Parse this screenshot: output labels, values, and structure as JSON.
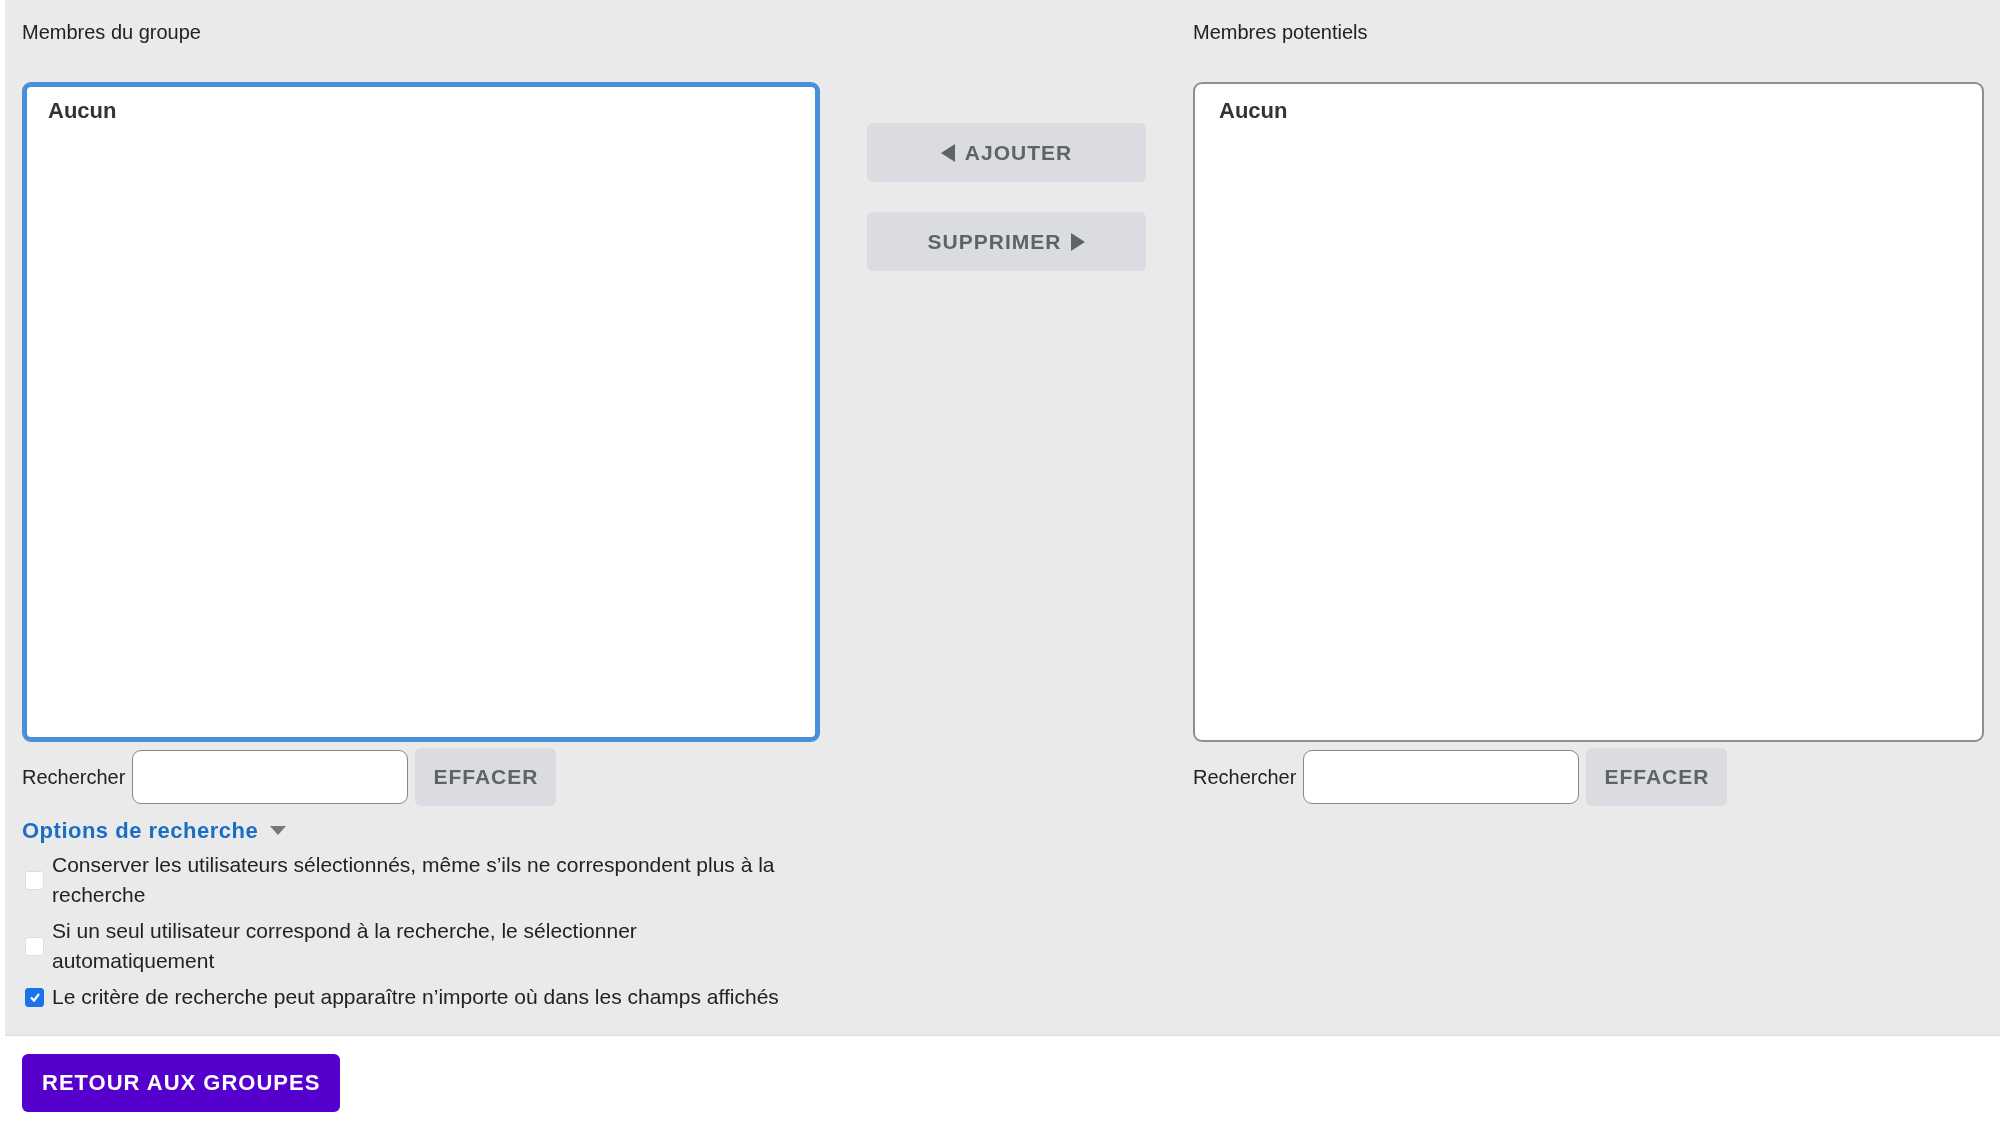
{
  "columns": [
    {
      "label": "Membres du groupe",
      "focused": true,
      "list_text": "Aucun",
      "search": {
        "label": "Rechercher",
        "button": "EFFACER"
      }
    },
    {
      "label": "Membres potentiels",
      "focused": false,
      "list_text": "Aucun",
      "search": {
        "label": "Rechercher",
        "button": "EFFACER"
      }
    }
  ],
  "actions": [
    {
      "label": "AJOUTER",
      "kind": "add"
    },
    {
      "label": "SUPPRIMER",
      "kind": "remove"
    }
  ],
  "search_options": {
    "title": "Options de recherche",
    "expanded": true,
    "options": [
      {
        "label": "Conserver les utilisateurs sélectionnés, même s’ils ne correspondent plus à la recherche",
        "checked": false
      },
      {
        "label": "Si un seul utilisateur correspond à la recherche, le sélectionner automatiquement",
        "checked": false
      },
      {
        "label": "Le critère de recherche peut apparaître n’importe où dans les champs affichés",
        "checked": true
      }
    ]
  },
  "back_button": "RETOUR AUX GROUPES"
}
